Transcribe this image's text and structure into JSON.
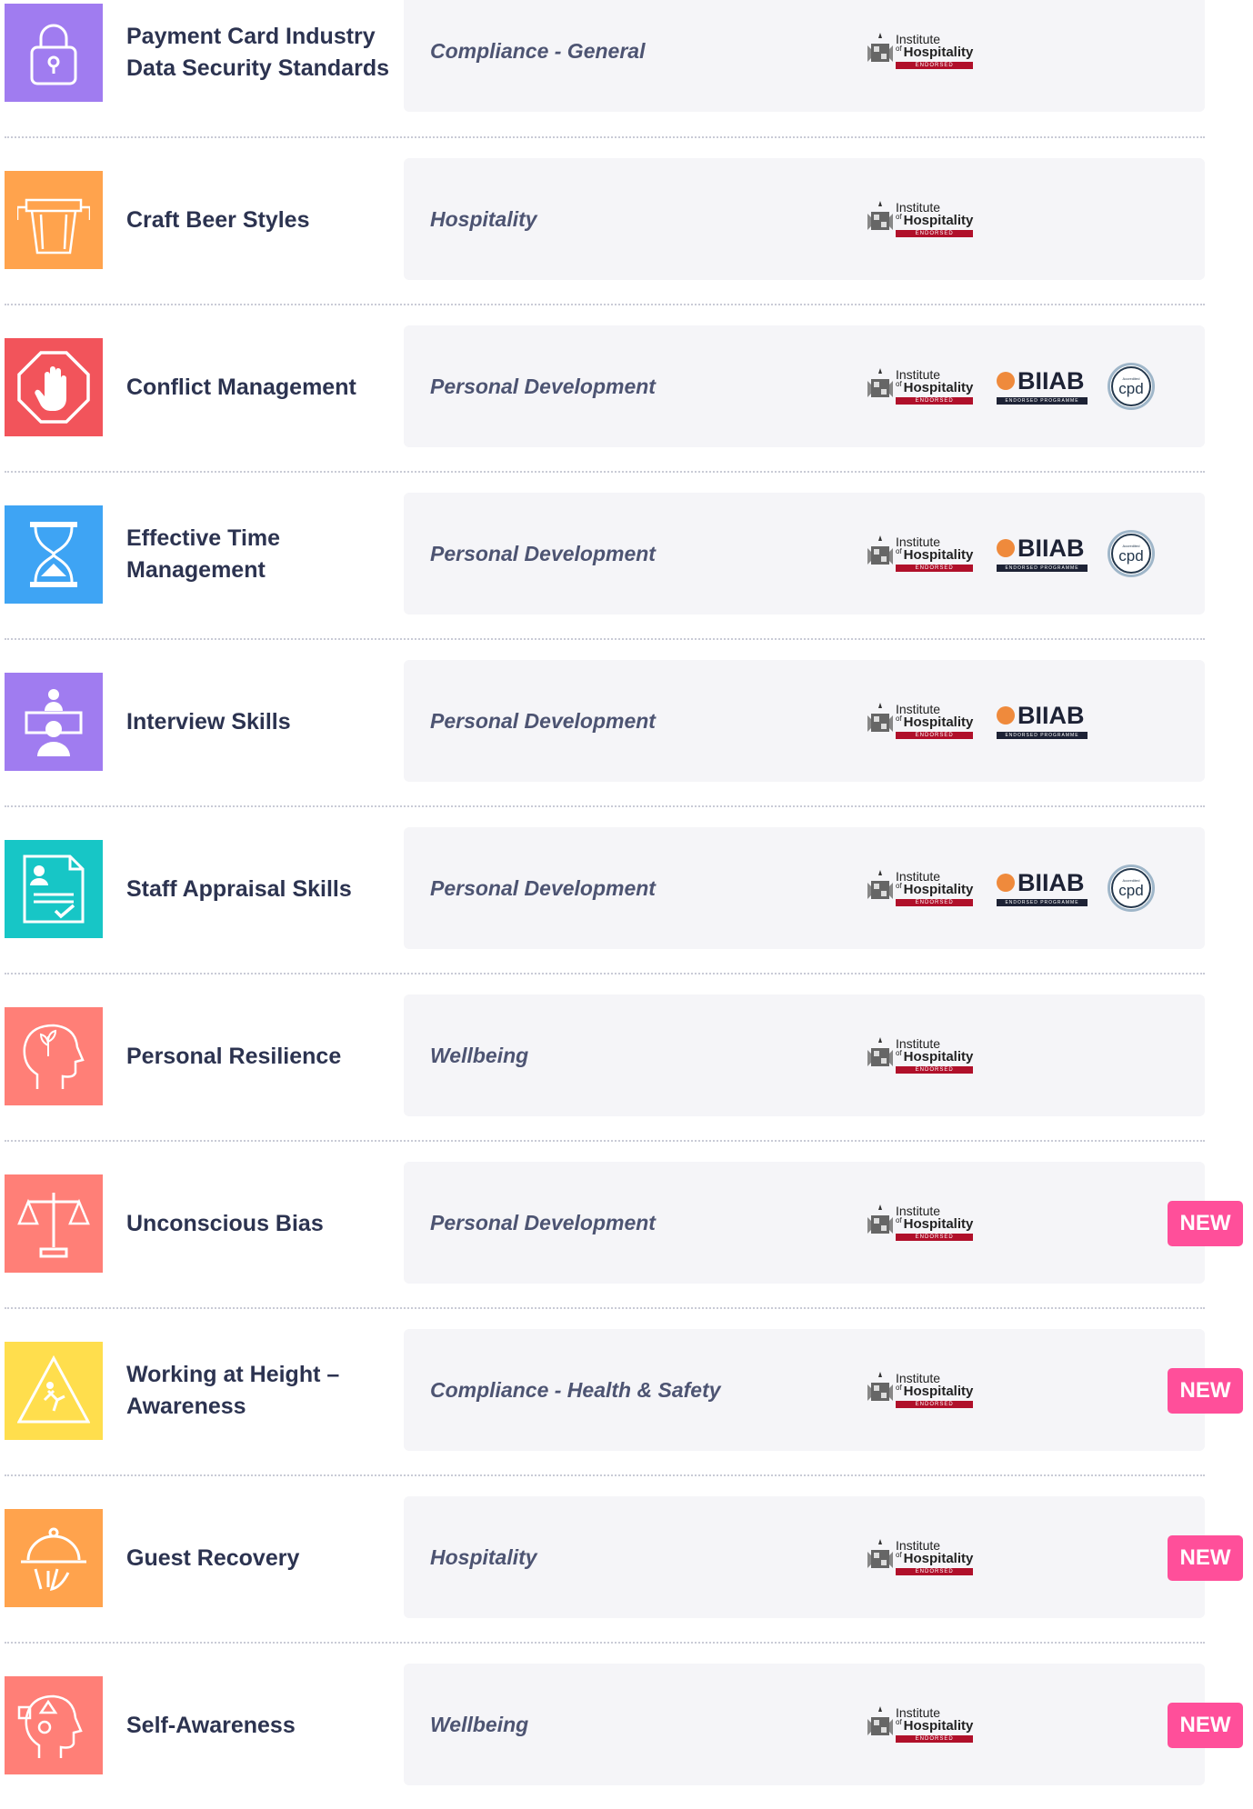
{
  "accreditations": {
    "ioh": {
      "line1": "Institute",
      "of": "of",
      "line2": "Hospitality",
      "endorsed": "ENDORSED"
    },
    "biiab": {
      "name": "BIIAB",
      "tag": "ENDORSED PROGRAMME"
    },
    "cpd": {
      "name": "cpd",
      "tag": "Accredited"
    }
  },
  "new_label": "NEW",
  "courses": [
    {
      "title": "Payment Card Industry Data Security Standards",
      "category": "Compliance - General",
      "icon": "padlock-icon",
      "color": "#a07cf0",
      "biiab": false,
      "cpd": false,
      "is_new": false
    },
    {
      "title": "Craft Beer Styles",
      "category": "Hospitality",
      "icon": "beer-glass-icon",
      "color": "#ffa34d",
      "biiab": false,
      "cpd": false,
      "is_new": false
    },
    {
      "title": "Conflict Management",
      "category": "Personal Development",
      "icon": "stop-hand-icon",
      "color": "#f2545b",
      "biiab": true,
      "cpd": true,
      "is_new": false
    },
    {
      "title": "Effective Time Management",
      "category": "Personal Development",
      "icon": "hourglass-icon",
      "color": "#3ea4f4",
      "biiab": true,
      "cpd": true,
      "is_new": false
    },
    {
      "title": "Interview Skills",
      "category": "Personal Development",
      "icon": "interview-icon",
      "color": "#a07cf0",
      "biiab": true,
      "cpd": false,
      "is_new": false
    },
    {
      "title": "Staff Appraisal Skills",
      "category": "Personal Development",
      "icon": "appraisal-document-icon",
      "color": "#17c6c6",
      "biiab": true,
      "cpd": true,
      "is_new": false
    },
    {
      "title": "Personal Resilience",
      "category": "Wellbeing",
      "icon": "head-plant-icon",
      "color": "#ff7f77",
      "biiab": false,
      "cpd": false,
      "is_new": false
    },
    {
      "title": "Unconscious Bias",
      "category": "Personal Development",
      "icon": "scales-icon",
      "color": "#ff7f77",
      "biiab": false,
      "cpd": false,
      "is_new": true
    },
    {
      "title": "Working at Height – Awareness",
      "category": "Compliance - Health & Safety",
      "icon": "falling-warning-icon",
      "color": "#ffde4d",
      "biiab": false,
      "cpd": false,
      "is_new": true
    },
    {
      "title": "Guest Recovery",
      "category": "Hospitality",
      "icon": "cloche-icon",
      "color": "#ffa34d",
      "biiab": false,
      "cpd": false,
      "is_new": true
    },
    {
      "title": "Self-Awareness",
      "category": "Wellbeing",
      "icon": "head-shapes-icon",
      "color": "#ff7f77",
      "biiab": false,
      "cpd": false,
      "is_new": true
    }
  ]
}
